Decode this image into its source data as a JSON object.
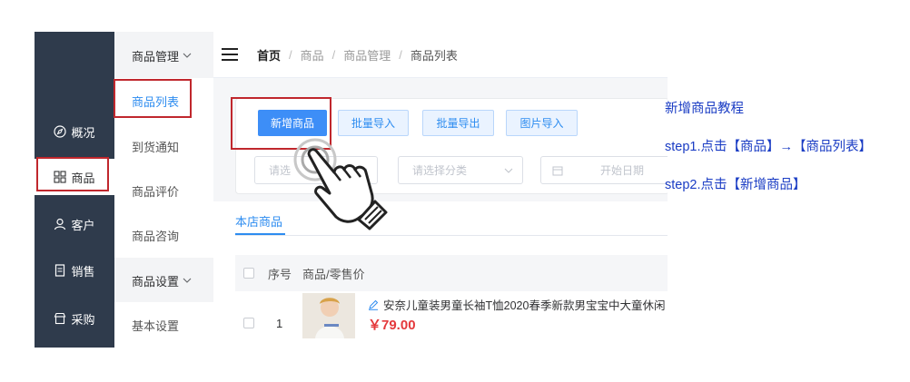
{
  "nav": {
    "items": [
      {
        "label": "概况",
        "icon": "compass-icon"
      },
      {
        "label": "商品",
        "icon": "grid-icon"
      },
      {
        "label": "客户",
        "icon": "user-icon"
      },
      {
        "label": "销售",
        "icon": "document-icon"
      },
      {
        "label": "采购",
        "icon": "shop-icon"
      }
    ]
  },
  "submenu": {
    "group1": "商品管理",
    "items": [
      "商品列表",
      "到货通知",
      "商品评价",
      "商品咨询"
    ],
    "group2": "商品设置",
    "after": "基本设置"
  },
  "breadcrumb": [
    "首页",
    "商品",
    "商品管理",
    "商品列表"
  ],
  "toolbar": {
    "add": "新增商品",
    "import": "批量导入",
    "export": "批量导出",
    "image_import": "图片导入"
  },
  "filters": {
    "status_placeholder": "请选",
    "category_placeholder": "请选择分类",
    "date_placeholder": "开始日期"
  },
  "tabs": {
    "active": "本店商品"
  },
  "table": {
    "headers": {
      "index": "序号",
      "product": "商品/零售价"
    },
    "rows": [
      {
        "index": "1",
        "name": "安奈儿童装男童长袖T恤2020春季新款男宝宝中大童休闲",
        "price": "￥79.00"
      }
    ]
  },
  "notes": {
    "title": "新增商品教程",
    "step1": "step1.点击【商品】→【商品列表】",
    "step2": "step2.点击【新增商品】"
  },
  "colors": {
    "nav_bg": "#2f3b4c",
    "primary": "#3d8ef7",
    "highlight": "#c0272d",
    "price": "#e4393c",
    "note": "#1a3cc4"
  }
}
